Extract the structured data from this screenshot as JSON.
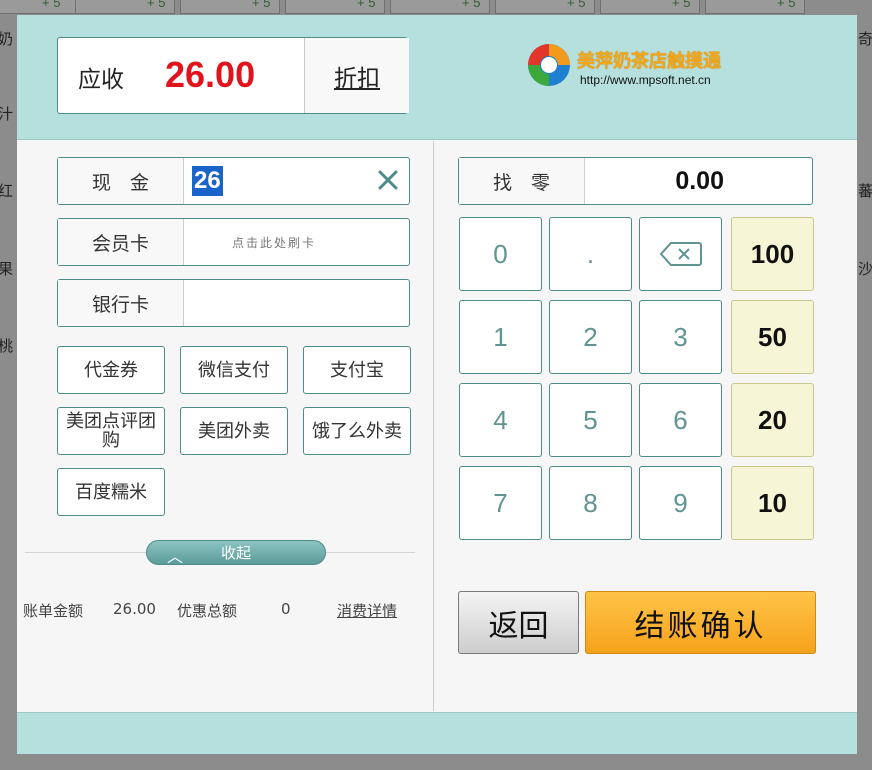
{
  "background": {
    "plus_labels": [
      "+ 5",
      "+ 5",
      "+ 5",
      "+ 5",
      "+ 5",
      "+ 5",
      "+ 5",
      "+ 5"
    ],
    "left_snippets": [
      "奶",
      "汁",
      "红",
      "果",
      "桃"
    ],
    "right_snippets": [
      "奇",
      "",
      "蕃",
      "沙",
      ""
    ]
  },
  "header": {
    "receivable_label": "应收",
    "receivable_amount": "26.00",
    "discount_label": "折扣",
    "logo_name": "美萍奶茶店触摸通",
    "logo_url": "http://www.mpsoft.net.cn"
  },
  "payment": {
    "cash_label": "现　金",
    "cash_value": "26",
    "member_label": "会员卡",
    "member_placeholder": "点击此处刷卡",
    "bank_label": "银行卡",
    "bank_value": ""
  },
  "methods": {
    "voucher": "代金券",
    "wechat": "微信支付",
    "alipay": "支付宝",
    "meituan_dianping": "美团点评团购",
    "meituan_takeout": "美团外卖",
    "eleme": "饿了么外卖",
    "baidu_nuomi": "百度糯米"
  },
  "collapse_label": "收起",
  "summary": {
    "bill_label": "账单金额",
    "bill_amount": "26.00",
    "discount_total_label": "优惠总额",
    "discount_total": "0",
    "details_link": "消费详情"
  },
  "change": {
    "label": "找　零",
    "value": "0.00"
  },
  "keypad": {
    "k0": "0",
    "dot": ".",
    "k1": "1",
    "k2": "2",
    "k3": "3",
    "k4": "4",
    "k5": "5",
    "k6": "6",
    "k7": "7",
    "k8": "8",
    "k9": "9",
    "amt100": "100",
    "amt50": "50",
    "amt20": "20",
    "amt10": "10"
  },
  "actions": {
    "back": "返回",
    "confirm": "结账确认"
  },
  "colors": {
    "band": "#b6e0de",
    "accent": "#4e8c8a",
    "amount_red": "#e0141c",
    "confirm_orange": "#f6a21c",
    "quick_amount_bg": "#f6f6d6"
  },
  "icons": {
    "clear": "close-icon",
    "backspace": "backspace-icon",
    "collapse": "chevron-up-icon",
    "logo": "mpsoft-logo-icon"
  }
}
